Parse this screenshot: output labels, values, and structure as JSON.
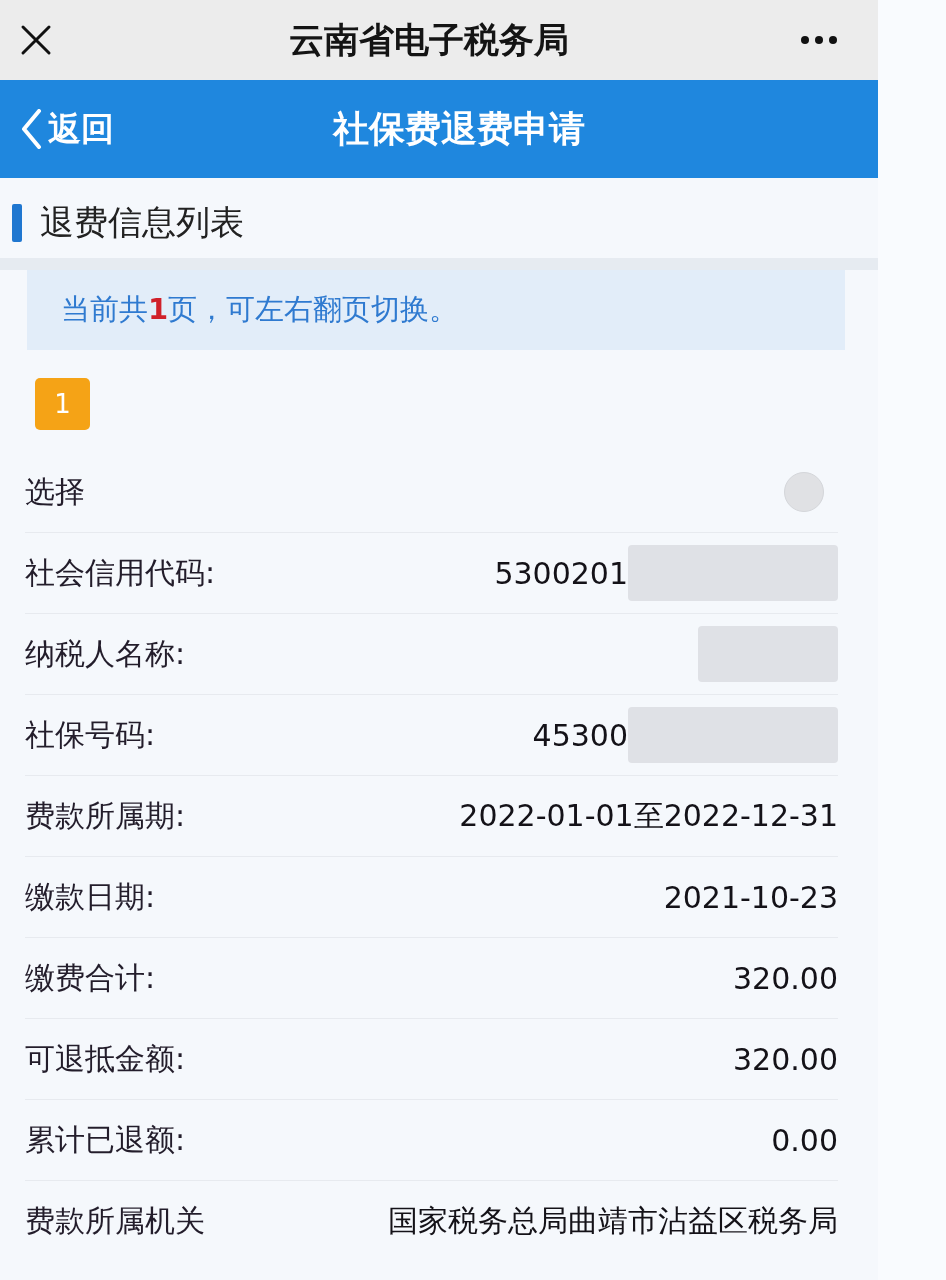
{
  "top_bar": {
    "title": "云南省电子税务局"
  },
  "nav_bar": {
    "back_label": "返回",
    "title": "社保费退费申请"
  },
  "section": {
    "title": "退费信息列表"
  },
  "notice": {
    "prefix": "当前共",
    "count": "1",
    "suffix": "页，可左右翻页切换。"
  },
  "record": {
    "badge": "1",
    "fields": [
      {
        "kind": "radio",
        "label": "选择",
        "selected": false
      },
      {
        "kind": "text",
        "label": "社会信用代码:",
        "value": "5300201",
        "redacted": true
      },
      {
        "kind": "text",
        "label": "纳税人名称:",
        "redacted": true
      },
      {
        "kind": "text",
        "label": "社保号码:",
        "value": "45300",
        "redacted": true
      },
      {
        "kind": "text",
        "label": "费款所属期:",
        "value": "2022-01-01至2022-12-31"
      },
      {
        "kind": "text",
        "label": "缴款日期:",
        "value": "2021-10-23"
      },
      {
        "kind": "text",
        "label": "缴费合计:",
        "value": "320.00"
      },
      {
        "kind": "text",
        "label": "可退抵金额:",
        "value": "320.00"
      },
      {
        "kind": "text",
        "label": "累计已退额:",
        "value": "0.00"
      },
      {
        "kind": "text",
        "label": "费款所属机关",
        "value": "国家税务总局曲靖市沾益区税务局"
      }
    ]
  }
}
